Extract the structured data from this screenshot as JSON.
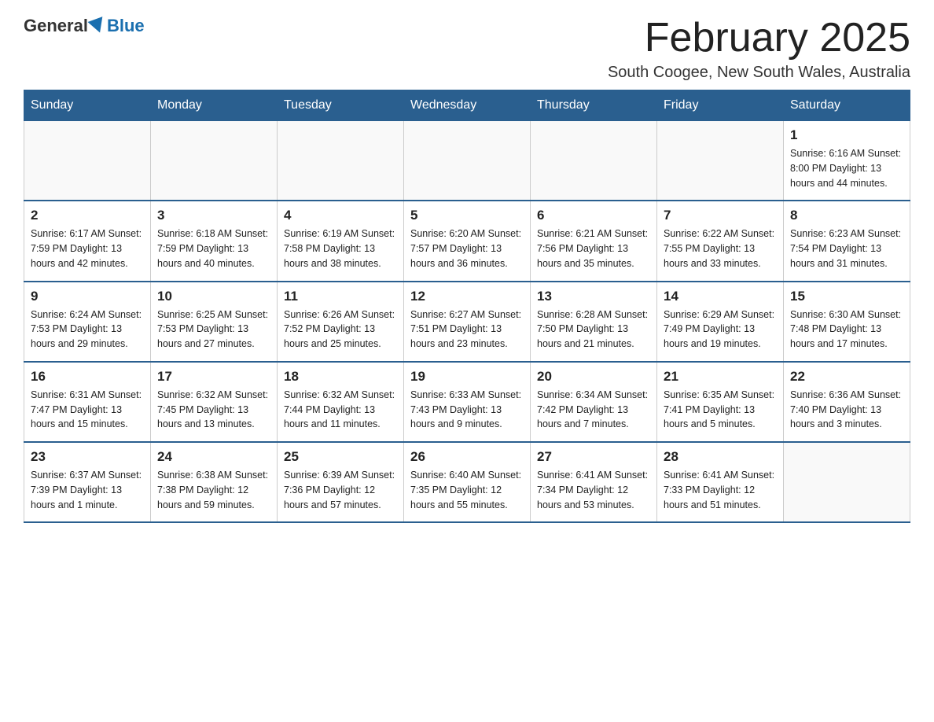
{
  "header": {
    "logo_general": "General",
    "logo_blue": "Blue",
    "month_title": "February 2025",
    "location": "South Coogee, New South Wales, Australia"
  },
  "days_of_week": [
    "Sunday",
    "Monday",
    "Tuesday",
    "Wednesday",
    "Thursday",
    "Friday",
    "Saturday"
  ],
  "weeks": [
    [
      {
        "day": "",
        "info": ""
      },
      {
        "day": "",
        "info": ""
      },
      {
        "day": "",
        "info": ""
      },
      {
        "day": "",
        "info": ""
      },
      {
        "day": "",
        "info": ""
      },
      {
        "day": "",
        "info": ""
      },
      {
        "day": "1",
        "info": "Sunrise: 6:16 AM\nSunset: 8:00 PM\nDaylight: 13 hours and 44 minutes."
      }
    ],
    [
      {
        "day": "2",
        "info": "Sunrise: 6:17 AM\nSunset: 7:59 PM\nDaylight: 13 hours and 42 minutes."
      },
      {
        "day": "3",
        "info": "Sunrise: 6:18 AM\nSunset: 7:59 PM\nDaylight: 13 hours and 40 minutes."
      },
      {
        "day": "4",
        "info": "Sunrise: 6:19 AM\nSunset: 7:58 PM\nDaylight: 13 hours and 38 minutes."
      },
      {
        "day": "5",
        "info": "Sunrise: 6:20 AM\nSunset: 7:57 PM\nDaylight: 13 hours and 36 minutes."
      },
      {
        "day": "6",
        "info": "Sunrise: 6:21 AM\nSunset: 7:56 PM\nDaylight: 13 hours and 35 minutes."
      },
      {
        "day": "7",
        "info": "Sunrise: 6:22 AM\nSunset: 7:55 PM\nDaylight: 13 hours and 33 minutes."
      },
      {
        "day": "8",
        "info": "Sunrise: 6:23 AM\nSunset: 7:54 PM\nDaylight: 13 hours and 31 minutes."
      }
    ],
    [
      {
        "day": "9",
        "info": "Sunrise: 6:24 AM\nSunset: 7:53 PM\nDaylight: 13 hours and 29 minutes."
      },
      {
        "day": "10",
        "info": "Sunrise: 6:25 AM\nSunset: 7:53 PM\nDaylight: 13 hours and 27 minutes."
      },
      {
        "day": "11",
        "info": "Sunrise: 6:26 AM\nSunset: 7:52 PM\nDaylight: 13 hours and 25 minutes."
      },
      {
        "day": "12",
        "info": "Sunrise: 6:27 AM\nSunset: 7:51 PM\nDaylight: 13 hours and 23 minutes."
      },
      {
        "day": "13",
        "info": "Sunrise: 6:28 AM\nSunset: 7:50 PM\nDaylight: 13 hours and 21 minutes."
      },
      {
        "day": "14",
        "info": "Sunrise: 6:29 AM\nSunset: 7:49 PM\nDaylight: 13 hours and 19 minutes."
      },
      {
        "day": "15",
        "info": "Sunrise: 6:30 AM\nSunset: 7:48 PM\nDaylight: 13 hours and 17 minutes."
      }
    ],
    [
      {
        "day": "16",
        "info": "Sunrise: 6:31 AM\nSunset: 7:47 PM\nDaylight: 13 hours and 15 minutes."
      },
      {
        "day": "17",
        "info": "Sunrise: 6:32 AM\nSunset: 7:45 PM\nDaylight: 13 hours and 13 minutes."
      },
      {
        "day": "18",
        "info": "Sunrise: 6:32 AM\nSunset: 7:44 PM\nDaylight: 13 hours and 11 minutes."
      },
      {
        "day": "19",
        "info": "Sunrise: 6:33 AM\nSunset: 7:43 PM\nDaylight: 13 hours and 9 minutes."
      },
      {
        "day": "20",
        "info": "Sunrise: 6:34 AM\nSunset: 7:42 PM\nDaylight: 13 hours and 7 minutes."
      },
      {
        "day": "21",
        "info": "Sunrise: 6:35 AM\nSunset: 7:41 PM\nDaylight: 13 hours and 5 minutes."
      },
      {
        "day": "22",
        "info": "Sunrise: 6:36 AM\nSunset: 7:40 PM\nDaylight: 13 hours and 3 minutes."
      }
    ],
    [
      {
        "day": "23",
        "info": "Sunrise: 6:37 AM\nSunset: 7:39 PM\nDaylight: 13 hours and 1 minute."
      },
      {
        "day": "24",
        "info": "Sunrise: 6:38 AM\nSunset: 7:38 PM\nDaylight: 12 hours and 59 minutes."
      },
      {
        "day": "25",
        "info": "Sunrise: 6:39 AM\nSunset: 7:36 PM\nDaylight: 12 hours and 57 minutes."
      },
      {
        "day": "26",
        "info": "Sunrise: 6:40 AM\nSunset: 7:35 PM\nDaylight: 12 hours and 55 minutes."
      },
      {
        "day": "27",
        "info": "Sunrise: 6:41 AM\nSunset: 7:34 PM\nDaylight: 12 hours and 53 minutes."
      },
      {
        "day": "28",
        "info": "Sunrise: 6:41 AM\nSunset: 7:33 PM\nDaylight: 12 hours and 51 minutes."
      },
      {
        "day": "",
        "info": ""
      }
    ]
  ]
}
